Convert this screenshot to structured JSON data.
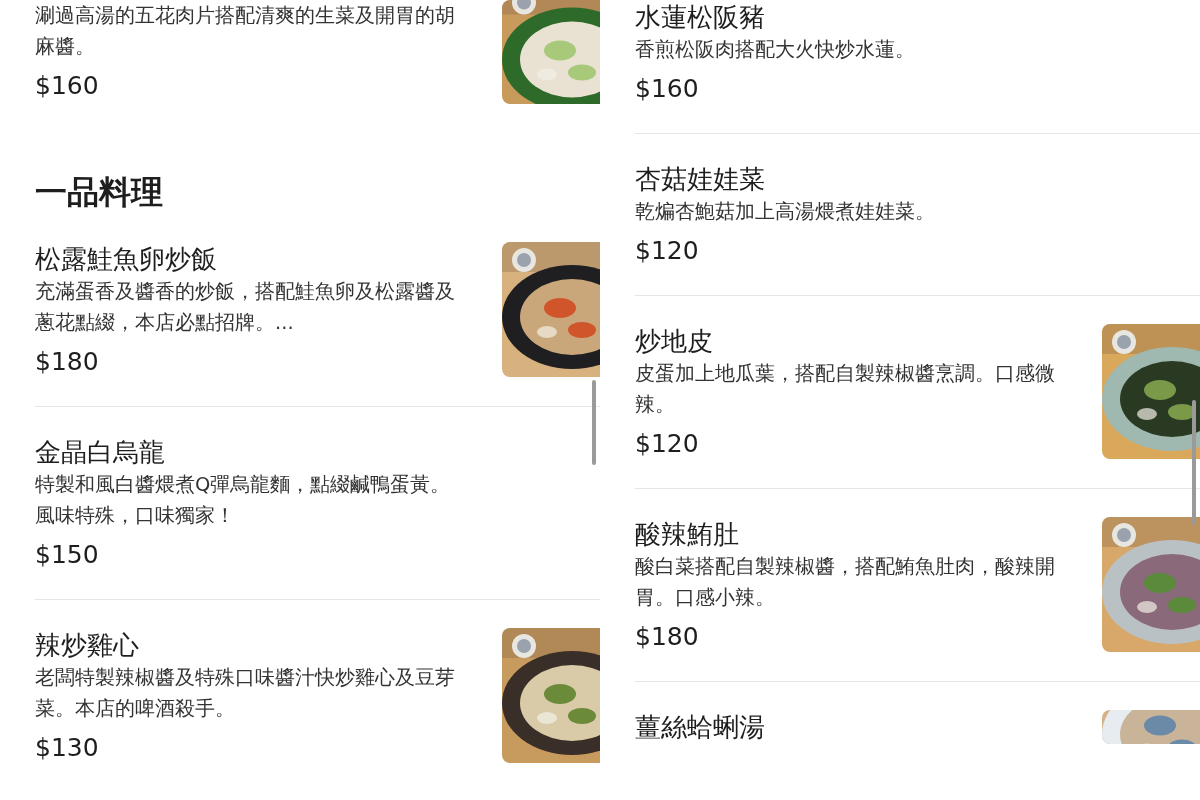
{
  "panels": [
    {
      "items": [
        {
          "kind": "dish",
          "description_lines": [
            "涮過高湯的五花肉片搭配清爽的生菜及開胃的胡",
            "麻醬。"
          ],
          "price": "$160"
        },
        {
          "kind": "heading",
          "title": "一品料理"
        },
        {
          "kind": "dish",
          "name": "松露鮭魚卵炒飯",
          "description_lines": [
            "充滿蛋香及醬香的炒飯，搭配鮭魚卵及松露醬及",
            "蔥花點綴，本店必點招牌。..."
          ],
          "price": "$180"
        },
        {
          "kind": "dish",
          "name": "金晶白烏龍",
          "description_lines": [
            "特製和風白醬煨煮Q彈烏龍麵，點綴鹹鴨蛋黃。",
            "風味特殊，口味獨家！"
          ],
          "price": "$150"
        },
        {
          "kind": "dish",
          "name": "辣炒雞心",
          "description_lines": [
            "老闆特製辣椒醬及特殊口味醬汁快炒雞心及豆芽",
            "菜。本店的啤酒殺手。"
          ],
          "price": "$130"
        }
      ]
    },
    {
      "items": [
        {
          "kind": "dish",
          "name": "水蓮松阪豬",
          "description_lines": [
            "香煎松阪肉搭配大火快炒水蓮。"
          ],
          "price": "$160"
        },
        {
          "kind": "dish",
          "name": "杏菇娃娃菜",
          "description_lines": [
            "乾煸杏鮑菇加上高湯煨煮娃娃菜。"
          ],
          "price": "$120"
        },
        {
          "kind": "dish",
          "name": "炒地皮",
          "description_lines": [
            "皮蛋加上地瓜葉，搭配自製辣椒醬烹調。口感微",
            "辣。"
          ],
          "price": "$120"
        },
        {
          "kind": "dish",
          "name": "酸辣鮪肚",
          "description_lines": [
            "酸白菜搭配自製辣椒醬，搭配鮪魚肚肉，酸辣開",
            "胃。口感小辣。"
          ],
          "price": "$180"
        },
        {
          "kind": "dish",
          "name": "薑絲蛤蜊湯"
        }
      ]
    }
  ]
}
